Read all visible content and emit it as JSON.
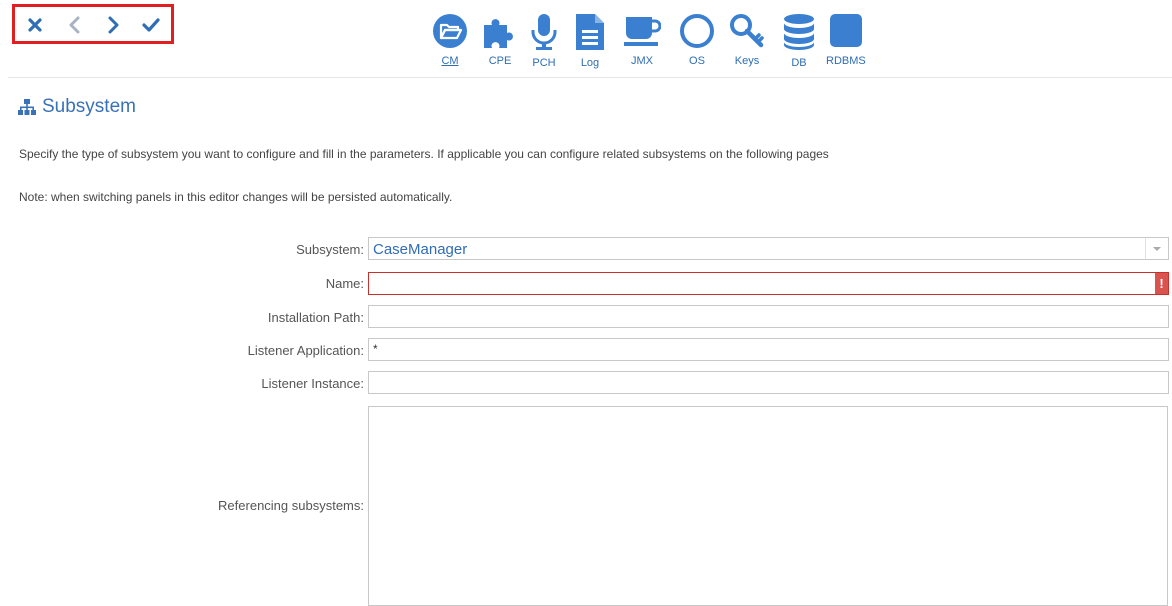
{
  "toolbar": {
    "nav": {
      "close": "close",
      "back": "back",
      "forward": "forward",
      "confirm": "confirm"
    },
    "items": [
      {
        "label": "CM",
        "icon": "folder-open-icon",
        "active": true
      },
      {
        "label": "CPE",
        "icon": "puzzle-piece-icon",
        "active": false
      },
      {
        "label": "PCH",
        "icon": "microphone-icon",
        "active": false
      },
      {
        "label": "Log",
        "icon": "document-icon",
        "active": false
      },
      {
        "label": "JMX",
        "icon": "coffee-cup-icon",
        "active": false
      },
      {
        "label": "OS",
        "icon": "circle-icon",
        "active": false
      },
      {
        "label": "Keys",
        "icon": "key-icon",
        "active": false
      },
      {
        "label": "DB",
        "icon": "database-icon",
        "active": false
      },
      {
        "label": "RDBMS",
        "icon": "square-icon",
        "active": false
      }
    ]
  },
  "section": {
    "title": "Subsystem",
    "description": "Specify the type of subsystem you want to configure and fill in the parameters. If applicable you can configure related subsystems on the following pages",
    "note": "Note: when switching panels in this editor changes will be persisted automatically."
  },
  "form": {
    "subsystem": {
      "label": "Subsystem:",
      "value": "CaseManager"
    },
    "name": {
      "label": "Name:",
      "value": "",
      "error_mark": "!"
    },
    "installation_path": {
      "label": "Installation Path:",
      "value": ""
    },
    "listener_application": {
      "label": "Listener Application:",
      "value": "*"
    },
    "listener_instance": {
      "label": "Listener Instance:",
      "value": ""
    },
    "referencing_subsystems": {
      "label": "Referencing subsystems:",
      "value": ""
    }
  },
  "colors": {
    "accent": "#3a7fd0",
    "link": "#2f6db5",
    "error": "#d9534f",
    "highlight_box": "#e02020"
  }
}
